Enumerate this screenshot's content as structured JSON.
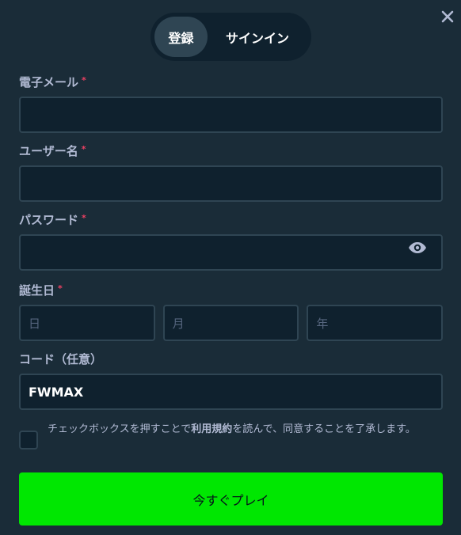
{
  "tabs": {
    "register": "登録",
    "signin": "サインイン"
  },
  "fields": {
    "email": {
      "label": "電子メール",
      "required": "*"
    },
    "username": {
      "label": "ユーザー名",
      "required": "*"
    },
    "password": {
      "label": "パスワード",
      "required": "*"
    },
    "dob": {
      "label": "誕生日",
      "required": "*",
      "day_placeholder": "日",
      "month_placeholder": "月",
      "year_placeholder": "年"
    },
    "code": {
      "label": "コード（任意）",
      "value": "FWMAX"
    }
  },
  "terms": {
    "prefix": "チェックボックスを押すことで",
    "link": "利用規約",
    "suffix": "を読んで、同意することを了承します。"
  },
  "play_button": "今すぐプレイ",
  "colors": {
    "background": "#1a2c38",
    "input_bg": "#0f212e",
    "border": "#2f4553",
    "accent_green": "#00e701",
    "required_red": "#ed4163"
  }
}
